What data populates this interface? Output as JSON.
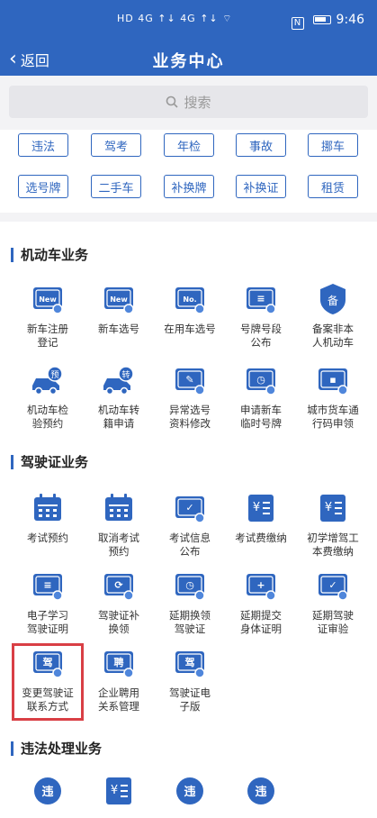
{
  "status_bar": {
    "left": "HD 4G ↑↓ 4G ↑↓ ⌔",
    "time": "9:46",
    "nfc": "N"
  },
  "nav": {
    "back_label": "返回",
    "title": "业务中心"
  },
  "search": {
    "placeholder": "搜索"
  },
  "chips": [
    {
      "label": "违法"
    },
    {
      "label": "驾考"
    },
    {
      "label": "年检"
    },
    {
      "label": "事故"
    },
    {
      "label": "挪车"
    },
    {
      "label": "选号牌"
    },
    {
      "label": "二手车"
    },
    {
      "label": "补换牌"
    },
    {
      "label": "补换证"
    },
    {
      "label": "租赁"
    }
  ],
  "sections": [
    {
      "title": "机动车业务",
      "items": [
        {
          "label": "新车注册\n登记",
          "icon": "new-plate-icon",
          "glyph": "New"
        },
        {
          "label": "新车选号",
          "icon": "new-plate-icon",
          "glyph": "New"
        },
        {
          "label": "在用车选号",
          "icon": "no-plate-icon",
          "glyph": "No."
        },
        {
          "label": "号牌号段\n公布",
          "icon": "plate-list-icon",
          "glyph": "≡"
        },
        {
          "label": "备案非本\n人机动车",
          "icon": "shield-icon",
          "glyph": "备"
        },
        {
          "label": "机动车检\n验预约",
          "icon": "car-check-icon",
          "glyph": "预"
        },
        {
          "label": "机动车转\n籍申请",
          "icon": "car-transfer-icon",
          "glyph": "转"
        },
        {
          "label": "异常选号\n资料修改",
          "icon": "edit-plate-icon",
          "glyph": "✎"
        },
        {
          "label": "申请新车\n临时号牌",
          "icon": "temp-plate-icon",
          "glyph": "◷"
        },
        {
          "label": "城市货车通\n行码申领",
          "icon": "truck-icon",
          "glyph": "▪"
        }
      ]
    },
    {
      "title": "驾驶证业务",
      "items": [
        {
          "label": "考试预约",
          "icon": "calendar-icon",
          "glyph": ""
        },
        {
          "label": "取消考试\n预约",
          "icon": "calendar-icon",
          "glyph": ""
        },
        {
          "label": "考试信息\n公布",
          "icon": "exam-info-icon",
          "glyph": "✓"
        },
        {
          "label": "考试费缴纳",
          "icon": "fee-icon",
          "glyph": "¥"
        },
        {
          "label": "初学增驾工\n本费缴纳",
          "icon": "fee-list-icon",
          "glyph": "¥"
        },
        {
          "label": "电子学习\n驾驶证明",
          "icon": "e-study-icon",
          "glyph": "≡"
        },
        {
          "label": "驾驶证补\n换领",
          "icon": "license-renew-icon",
          "glyph": "⟳"
        },
        {
          "label": "延期换领\n驾驶证",
          "icon": "license-delay-icon",
          "glyph": "◷"
        },
        {
          "label": "延期提交\n身体证明",
          "icon": "health-delay-icon",
          "glyph": "+"
        },
        {
          "label": "延期驾驶\n证审验",
          "icon": "license-verify-icon",
          "glyph": "✓"
        },
        {
          "label": "变更驾驶证\n联系方式",
          "icon": "license-contact-icon",
          "glyph": "驾"
        },
        {
          "label": "企业聘用\n关系管理",
          "icon": "employ-icon",
          "glyph": "聘"
        },
        {
          "label": "驾驶证电\n子版",
          "icon": "e-license-icon",
          "glyph": "驾"
        }
      ]
    },
    {
      "title": "违法处理业务",
      "items": [
        {
          "label": "",
          "icon": "violation-search-icon",
          "glyph": "违"
        },
        {
          "label": "",
          "icon": "fine-pay-icon",
          "glyph": "¥"
        },
        {
          "label": "",
          "icon": "violation-handle-icon",
          "glyph": "违"
        },
        {
          "label": "",
          "icon": "violation-report-icon",
          "glyph": "违"
        }
      ]
    }
  ],
  "colors": {
    "brand": "#2f66bf",
    "highlight": "#d93f45"
  }
}
